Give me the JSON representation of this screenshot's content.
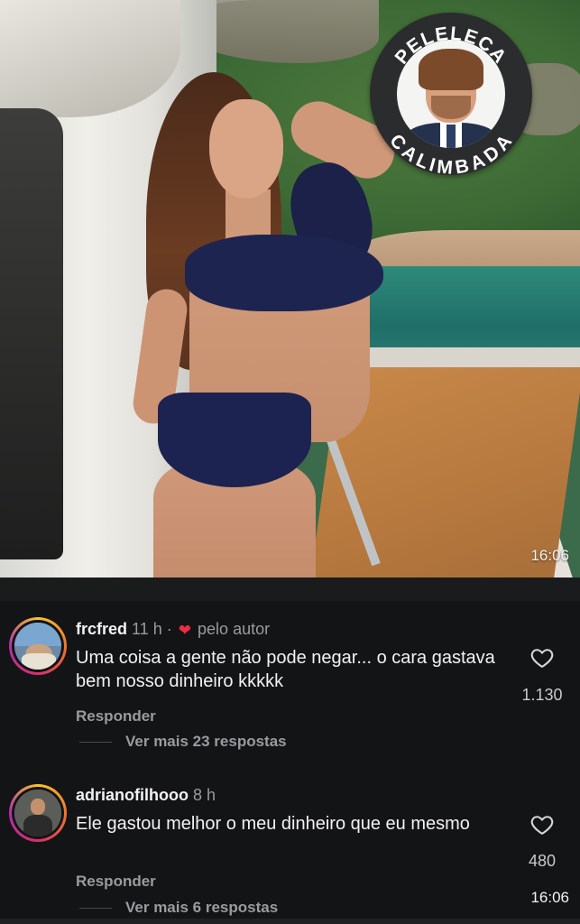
{
  "photo": {
    "timestamp": "16:06"
  },
  "badge": {
    "top_text": "PELELECA",
    "bottom_text": "CALIMBADA"
  },
  "comments": [
    {
      "username": "frcfred",
      "age": "11 h",
      "author_liked_label": "pelo autor",
      "text": "Uma coisa a gente não pode negar... o cara gastava bem nosso dinheiro kkkkk",
      "reply_label": "Responder",
      "more_replies": "Ver mais 23 respostas",
      "likes": "1.130"
    },
    {
      "username": "adrianofilhooo",
      "age": "8 h",
      "text": "Ele gastou melhor o meu dinheiro que eu mesmo",
      "reply_label": "Responder",
      "more_replies": "Ver mais 6 respostas",
      "likes": "480"
    }
  ],
  "status": {
    "timestamp": "16:06"
  },
  "icons": {
    "like": "heart-outline-icon",
    "author_like": "heart-filled-icon"
  },
  "colors": {
    "background": "#131416",
    "author_heart": "#ed2c45",
    "muted_text": "#9a9b9e"
  }
}
